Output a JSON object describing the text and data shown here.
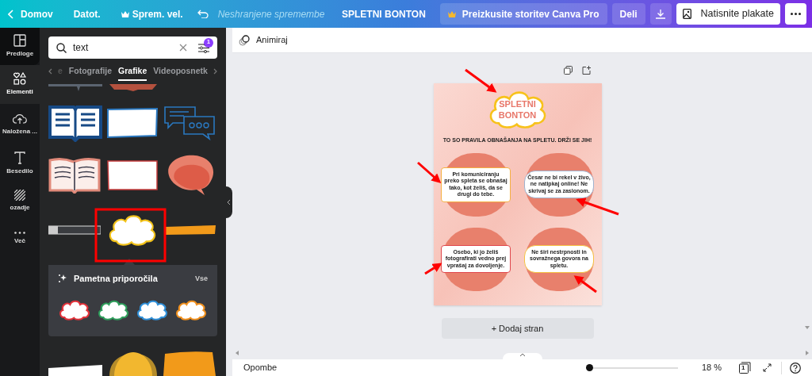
{
  "topbar": {
    "back": "Domov",
    "file": "Datot.",
    "resize": "Sprem. vel.",
    "save_status": "Neshranjene spremembe",
    "title": "SPLETNI BONTON",
    "pro": "Preizkusite storitev Canva Pro",
    "share": "Deli",
    "print": "Natisnite plakate"
  },
  "rail": [
    {
      "kind": "templates",
      "label": "Predloge",
      "selected": false
    },
    {
      "kind": "elements",
      "label": "Elementi",
      "selected": true
    },
    {
      "kind": "uploads",
      "label": "Naložena ...",
      "selected": false
    },
    {
      "kind": "text",
      "label": "Besedilo",
      "selected": false
    },
    {
      "kind": "background",
      "label": "ozadje",
      "selected": false
    },
    {
      "kind": "more",
      "label": "Več",
      "selected": false
    }
  ],
  "search": {
    "value": "text",
    "filter_badge": "1"
  },
  "categories": [
    {
      "label": "e",
      "selected": false
    },
    {
      "label": "Fotografije",
      "selected": false
    },
    {
      "label": "Grafike",
      "selected": true
    },
    {
      "label": "Videoposnetk",
      "selected": false
    }
  ],
  "suggestions": {
    "title": "Pametna priporočila",
    "see_all": "Vse",
    "items": [
      {
        "color": "#e2323a"
      },
      {
        "color": "#2e9e5b"
      },
      {
        "color": "#2f8fd8"
      },
      {
        "color": "#f0901e"
      }
    ]
  },
  "toolbar": {
    "animate": "Animiraj"
  },
  "poster": {
    "title": "SPLETNI BONTON",
    "subtitle": "TO SO PRAVILA OBNAŠANJA NA SPLETU. DRŽI SE JIH!",
    "tips": [
      "Pri komuniciranju preko spleta se obnašaj tako, kot želiš, da se drugi do tebe.",
      "Česar ne bi rekel v živo, ne natipkaj online! Ne skrivaj se za zaslonom.",
      "Osebo, ki jo želiš fotografirati vedno prej vprašaj za dovoljenje.",
      "Ne širi nestrpnosti in sovražnega govora na spletu."
    ]
  },
  "add_page": "+ Dodaj stran",
  "footer": {
    "notes": "Opombe",
    "zoom_slider": {
      "level": 0
    },
    "zoom": "18 %",
    "page_count": "1"
  }
}
